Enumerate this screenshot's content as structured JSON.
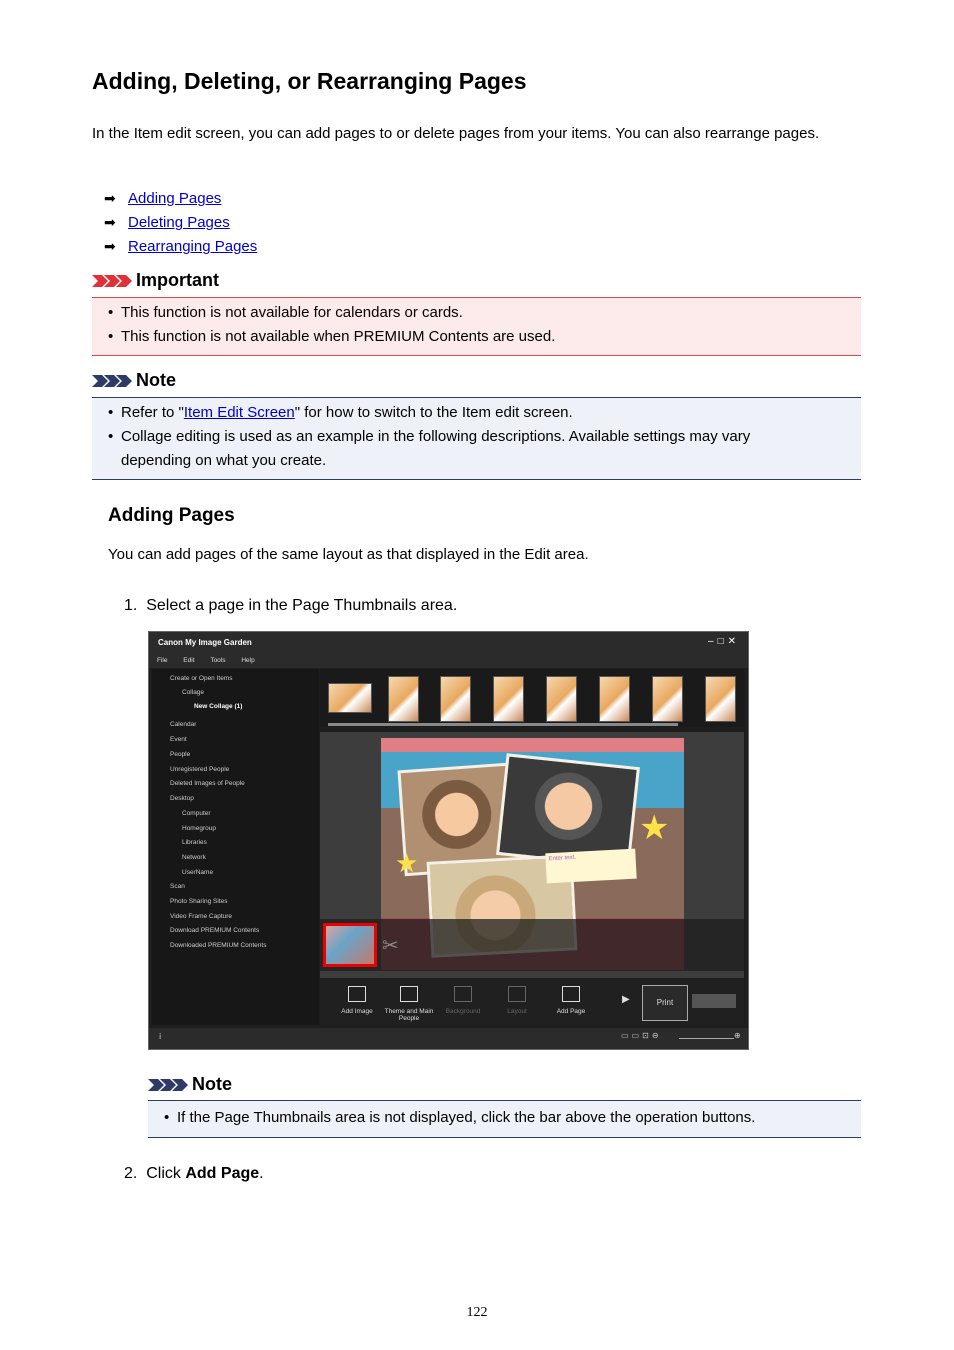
{
  "title": "Adding, Deleting, or Rearranging Pages",
  "intro": "In the Item edit screen, you can add pages to or delete pages from your items. You can also rearrange pages.",
  "links": [
    "Adding Pages",
    "Deleting Pages",
    "Rearranging Pages"
  ],
  "important": {
    "heading": "Important",
    "items": [
      "This function is not available for calendars or cards.",
      "This function is not available when PREMIUM Contents are used."
    ]
  },
  "note1": {
    "heading": "Note",
    "item1_pre": "Refer to \"",
    "item1_link": "Item Edit Screen",
    "item1_post": "\" for how to switch to the Item edit screen.",
    "item2": "Collage editing is used as an example in the following descriptions. Available settings may vary depending on what you create."
  },
  "section": {
    "heading": "Adding Pages",
    "desc": "You can add pages of the same layout as that displayed in the Edit area.",
    "step1": "Select a page in the Page Thumbnails area.",
    "step2_pre": "Click ",
    "step2_bold": "Add Page",
    "step2_post": "."
  },
  "screenshot": {
    "app_title": "Canon My Image Garden",
    "menu": [
      "File",
      "Edit",
      "Tools",
      "Help"
    ],
    "tree": [
      "Create or Open Items",
      "Collage",
      "New Collage (1)",
      "Calendar",
      "Event",
      "People",
      "Unregistered People",
      "Deleted Images of People",
      "Desktop",
      "Computer",
      "Homegroup",
      "Libraries",
      "Network",
      "UserName",
      "Scan",
      "Photo Sharing Sites",
      "Video Frame Capture",
      "Download PREMIUM Contents",
      "Downloaded PREMIUM Contents"
    ],
    "note_text": "Enter text.",
    "ops": [
      "Add Image",
      "Theme and Main People",
      "Background",
      "Layout",
      "Add Page"
    ],
    "print": "Print"
  },
  "note2": {
    "heading": "Note",
    "item": "If the Page Thumbnails area is not displayed, click the bar above the operation buttons."
  },
  "page_number": "122"
}
